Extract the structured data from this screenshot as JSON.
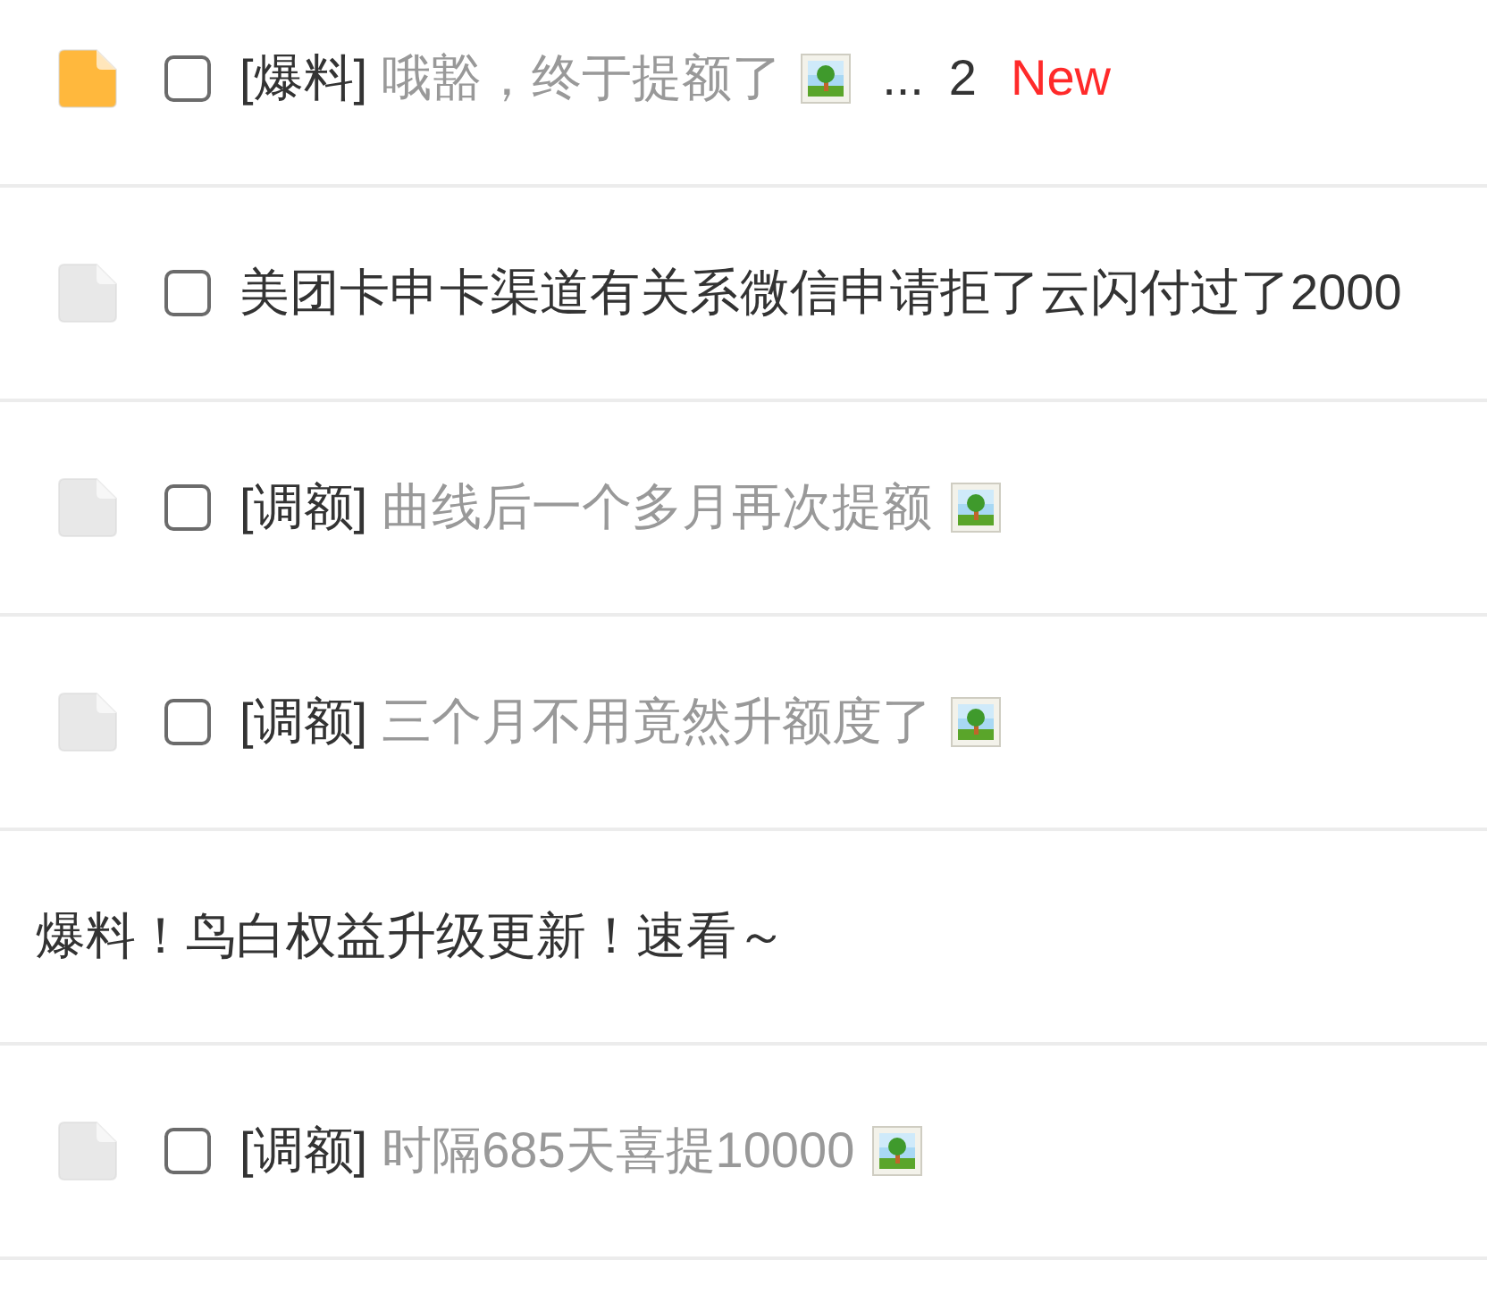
{
  "threads": [
    {
      "kind": "thread",
      "color": "#ffb83d",
      "checked": false,
      "tag": "[爆料]",
      "title": "哦豁，终于提额了",
      "title_muted": true,
      "has_image": true,
      "more_pages": {
        "ellipsis": "...",
        "pages": [
          "2"
        ]
      },
      "badge": "New"
    },
    {
      "kind": "thread",
      "color": "#e8e8e8",
      "checked": false,
      "title": "美团卡申卡渠道有关系微信申请拒了云闪付过了2000",
      "title_muted": false,
      "has_image": false
    },
    {
      "kind": "thread",
      "color": "#e8e8e8",
      "checked": false,
      "tag": "[调额]",
      "title": "曲线后一个多月再次提额",
      "title_muted": true,
      "has_image": true
    },
    {
      "kind": "thread",
      "color": "#e8e8e8",
      "checked": false,
      "tag": "[调额]",
      "title": "三个月不用竟然升额度了",
      "title_muted": true,
      "has_image": true
    },
    {
      "kind": "notice",
      "title": "爆料！鸟白权益升级更新！速看～"
    },
    {
      "kind": "thread",
      "color": "#e8e8e8",
      "checked": false,
      "tag": "[调额]",
      "title": "时隔685天喜提10000",
      "title_muted": true,
      "has_image": true
    }
  ]
}
